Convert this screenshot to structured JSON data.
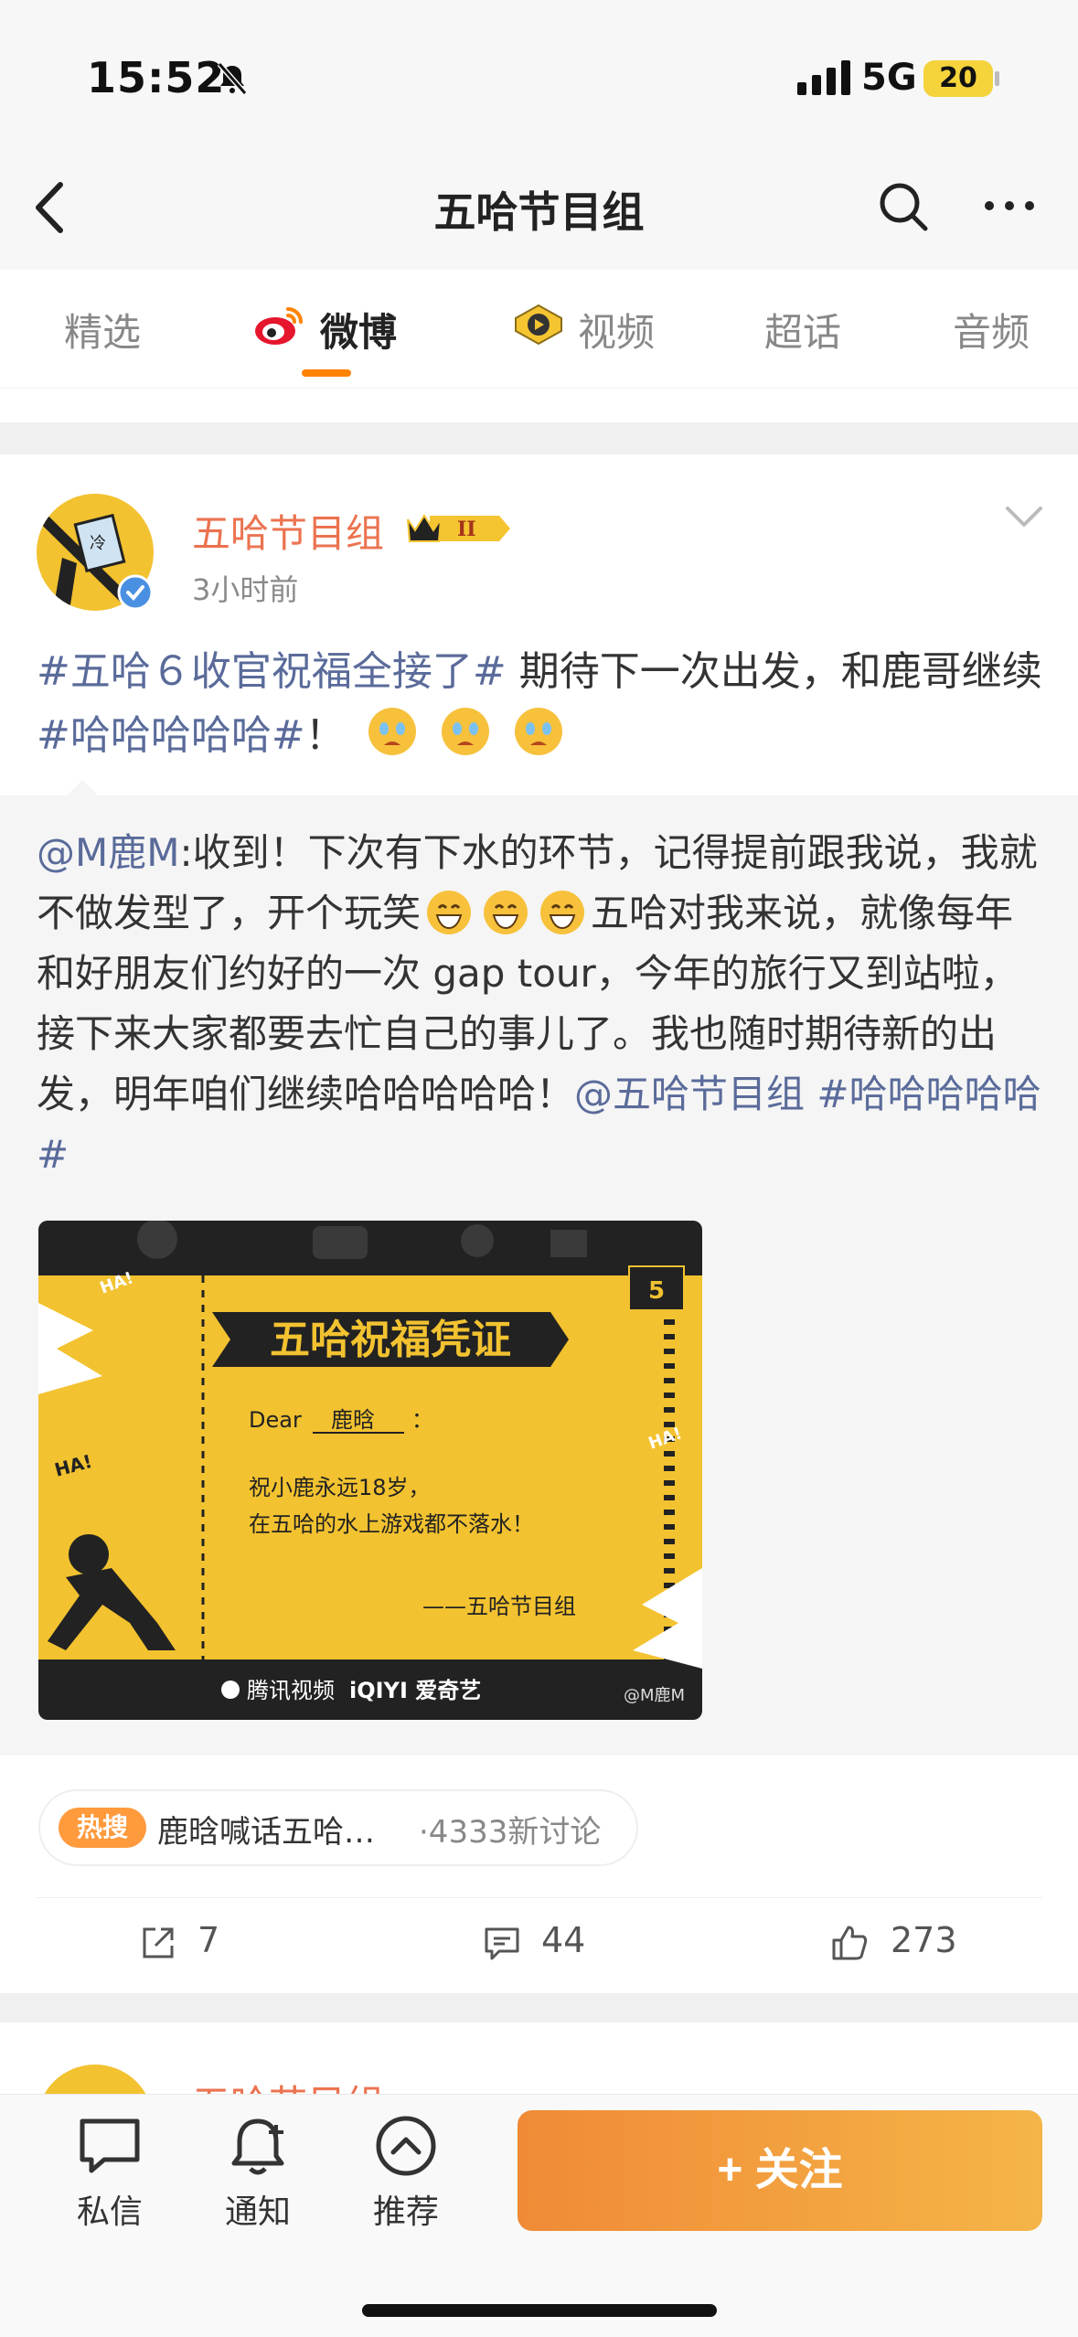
{
  "status_bar": {
    "time": "15:52",
    "network": "5G",
    "battery": "20"
  },
  "nav": {
    "title": "五哈节目组"
  },
  "tabs": [
    {
      "label": "精选",
      "active": false
    },
    {
      "label": "微博",
      "active": true
    },
    {
      "label": "视频",
      "active": false
    },
    {
      "label": "超话",
      "active": false
    },
    {
      "label": "音频",
      "active": false
    }
  ],
  "post": {
    "author": "五哈节目组",
    "time": "3小时前",
    "topic1": "#五哈６收官祝福全接了#",
    "text1": " 期待下一次出发，和鹿哥继续",
    "topic2": "#哈哈哈哈哈#",
    "text2": "！",
    "repost": {
      "mention": "@M鹿M",
      "text_a": ":收到！下次有下水的环节，记得提前跟我说，我就不做发型了，开个玩笑",
      "text_b": "五哈对我来说，就像每年和好朋友们约好的一次 gap tour，今年的旅行又到站啦，接下来大家都要去忙自己的事儿了。我也随时期待新的出发，明年咱们继续哈哈哈哈哈！",
      "mention2": "@五哈节目组",
      "topic": "#哈哈哈哈哈#"
    },
    "image": {
      "title": "五哈祝福凭证",
      "dear": "Dear",
      "name": "鹿晗",
      "colon": "：",
      "line1": "祝小鹿永远18岁，",
      "line2": "在五哈的水上游戏都不落水！",
      "sign": "——五哈节目组",
      "ha1": "HA!",
      "ha2": "HA!",
      "ha3": "HA!",
      "footer_tencent": "腾讯视频",
      "footer_iqiyi": "iQIYI 爱奇艺",
      "watermark": "@M鹿M"
    },
    "hot": {
      "badge": "热搜",
      "text": "鹿晗喊话五哈…",
      "count": "·4333新讨论"
    },
    "actions": {
      "repost": "7",
      "comment": "44",
      "like": "273"
    }
  },
  "next_post": {
    "author": "五哈节目组"
  },
  "bottom_bar": {
    "message": "私信",
    "notify": "通知",
    "recommend": "推荐",
    "follow": "+ 关注"
  },
  "colors": {
    "accent": "#eb7350",
    "topic": "#5a6b9a",
    "follow_start": "#f08a36",
    "follow_end": "#f5b548",
    "tab_indicator": "#ff8200"
  }
}
